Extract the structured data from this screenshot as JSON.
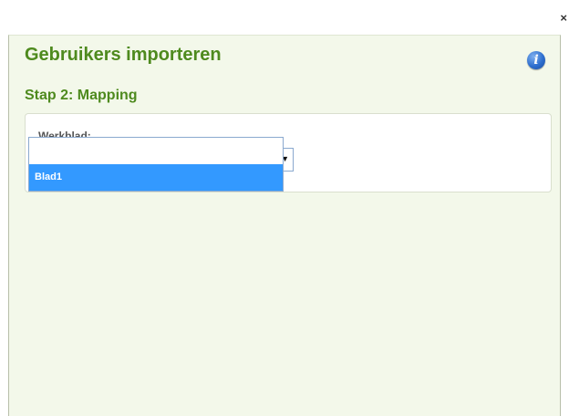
{
  "dialog": {
    "close_label": "×",
    "title": "Gebruikers importeren",
    "info_label": "i",
    "step_title": "Stap 2: Mapping"
  },
  "form": {
    "worksheet_label": "Werkblad:",
    "worksheet_value": "",
    "arrow_label": "▼",
    "options": [
      {
        "label": "",
        "highlighted": false
      },
      {
        "label": "Blad1",
        "highlighted": true
      }
    ]
  },
  "colors": {
    "title": "#4e8a1e",
    "dialog_background": "#f3f8ea",
    "highlight": "#3399ff"
  },
  "icons": {
    "close": "close-icon",
    "info": "info-icon",
    "dropdown_arrow": "chevron-down-icon"
  }
}
